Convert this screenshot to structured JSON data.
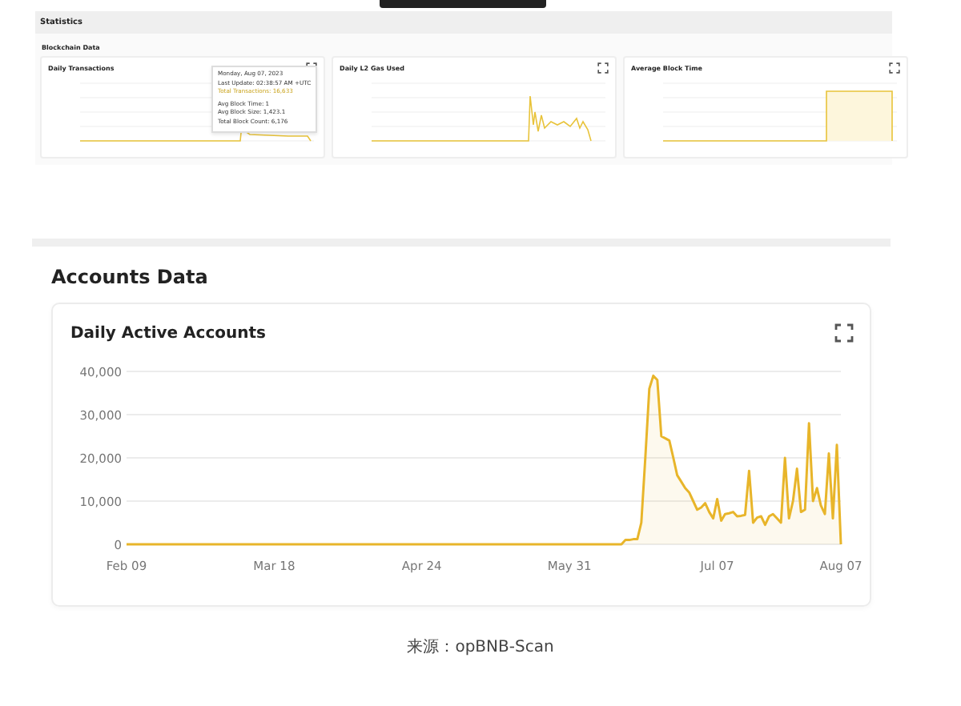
{
  "statistics": {
    "title": "Statistics",
    "tab": "Blockchain Data",
    "cards": [
      {
        "title": "Daily Transactions",
        "kind": "spike",
        "tooltip": {
          "date": "Monday, Aug 07, 2023",
          "lines": [
            "Last Update: 02:38:57 AM +UTC",
            "Total Transactions: 16,633",
            "Avg Block Time: 1",
            "Avg Block Size: 1,423.1",
            "Total Block Count: 6,176"
          ]
        }
      },
      {
        "title": "Daily L2 Gas Used",
        "kind": "noisy"
      },
      {
        "title": "Average Block Time",
        "kind": "step"
      }
    ]
  },
  "accounts": {
    "title": "Accounts Data",
    "card": {
      "title": "Daily Active Accounts",
      "chart_data": {
        "type": "area",
        "categories": [
          "Feb 09",
          null,
          null,
          null,
          null,
          null,
          null,
          null,
          null,
          null,
          null,
          null,
          null,
          null,
          null,
          null,
          null,
          null,
          null,
          null,
          null,
          null,
          null,
          null,
          null,
          null,
          null,
          null,
          null,
          null,
          null,
          null,
          null,
          null,
          null,
          null,
          null,
          "Mar 18",
          null,
          null,
          null,
          null,
          null,
          null,
          null,
          null,
          null,
          null,
          null,
          null,
          null,
          null,
          null,
          null,
          null,
          null,
          null,
          null,
          null,
          null,
          null,
          null,
          null,
          null,
          null,
          null,
          null,
          null,
          null,
          null,
          null,
          null,
          null,
          null,
          "Apr 24",
          null,
          null,
          null,
          null,
          null,
          null,
          null,
          null,
          null,
          null,
          null,
          null,
          null,
          null,
          null,
          null,
          null,
          null,
          null,
          null,
          null,
          null,
          null,
          null,
          null,
          null,
          null,
          null,
          null,
          null,
          null,
          null,
          null,
          null,
          null,
          null,
          "May 31",
          null,
          null,
          null,
          null,
          null,
          null,
          null,
          null,
          null,
          null,
          null,
          null,
          null,
          null,
          null,
          null,
          null,
          null,
          null,
          null,
          null,
          null,
          null,
          null,
          null,
          null,
          null,
          null,
          null,
          null,
          null,
          null,
          null,
          null,
          null,
          null,
          "Jul 07",
          null,
          null,
          null,
          null,
          null,
          null,
          null,
          null,
          null,
          null,
          null,
          null,
          null,
          null,
          null,
          null,
          null,
          null,
          null,
          null,
          null,
          null,
          null,
          null,
          null,
          null,
          null,
          null,
          null,
          null,
          "Aug 07"
        ],
        "series": [
          {
            "color": "#e8b52a",
            "values": [
              0,
              0,
              0,
              0,
              0,
              0,
              0,
              0,
              0,
              0,
              0,
              0,
              0,
              0,
              0,
              0,
              0,
              0,
              0,
              0,
              0,
              0,
              0,
              0,
              0,
              0,
              0,
              0,
              0,
              0,
              0,
              0,
              0,
              0,
              0,
              0,
              0,
              0,
              0,
              0,
              0,
              0,
              0,
              0,
              0,
              0,
              0,
              0,
              0,
              0,
              0,
              0,
              0,
              0,
              0,
              0,
              0,
              0,
              0,
              0,
              0,
              0,
              0,
              0,
              0,
              0,
              0,
              0,
              0,
              0,
              0,
              0,
              0,
              0,
              0,
              0,
              0,
              0,
              0,
              0,
              0,
              0,
              0,
              0,
              0,
              0,
              0,
              0,
              0,
              0,
              0,
              0,
              0,
              0,
              0,
              0,
              0,
              0,
              0,
              0,
              0,
              0,
              0,
              0,
              0,
              0,
              0,
              0,
              0,
              0,
              0,
              0,
              0,
              0,
              0,
              0,
              0,
              0,
              0,
              0,
              0,
              0,
              0,
              0,
              0,
              1000,
              1000,
              1200,
              1200,
              5000,
              20000,
              36000,
              39000,
              38000,
              25000,
              24500,
              24000,
              20000,
              16000,
              14500,
              13000,
              12000,
              10000,
              8000,
              8500,
              9500,
              7500,
              6000,
              10500,
              5500,
              7000,
              7200,
              7500,
              6500,
              6600,
              6800,
              17000,
              5000,
              6200,
              6500,
              4500,
              6500,
              7000,
              6000,
              5000,
              20000,
              6000,
              10000,
              17500,
              7500,
              8000,
              28000,
              10000,
              13000,
              9000,
              7000,
              21000,
              6000,
              23000,
              0
            ]
          }
        ],
        "ylim": [
          0,
          40000
        ],
        "grid": true,
        "yticks": [
          {
            "value": 0,
            "label": "0"
          },
          {
            "value": 10000,
            "label": "10,000"
          },
          {
            "value": 20000,
            "label": "20,000"
          },
          {
            "value": 30000,
            "label": "30,000"
          },
          {
            "value": 40000,
            "label": "40,000"
          }
        ]
      }
    }
  },
  "caption": "来源：opBNB-Scan"
}
